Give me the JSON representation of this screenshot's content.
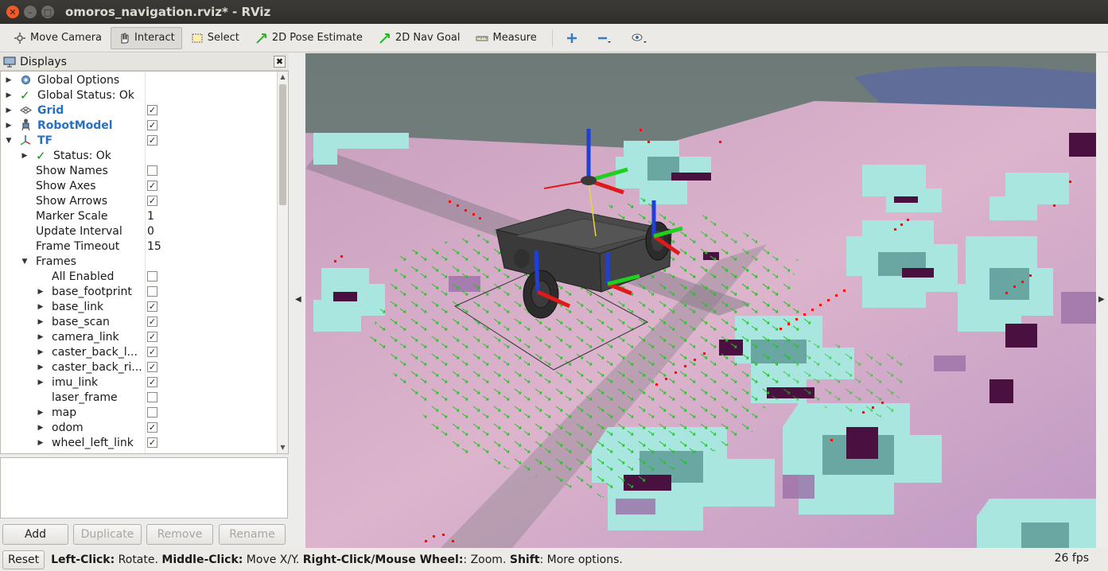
{
  "window": {
    "title": "omoros_navigation.rviz* - RViz"
  },
  "toolbar": {
    "move_camera": "Move Camera",
    "interact": "Interact",
    "select": "Select",
    "pose_estimate": "2D Pose Estimate",
    "nav_goal": "2D Nav Goal",
    "measure": "Measure"
  },
  "panel": {
    "title": "Displays",
    "close": "✖",
    "rows": [
      {
        "name": "Global Options"
      },
      {
        "name": "Global Status: Ok"
      },
      {
        "name": "Grid",
        "checked": "✓"
      },
      {
        "name": "RobotModel",
        "checked": "✓"
      },
      {
        "name": "TF",
        "checked": "✓"
      },
      {
        "name": "Status: Ok"
      },
      {
        "name": "Show Names",
        "checked": ""
      },
      {
        "name": "Show Axes",
        "checked": "✓"
      },
      {
        "name": "Show Arrows",
        "checked": "✓"
      },
      {
        "name": "Marker Scale",
        "value": "1"
      },
      {
        "name": "Update Interval",
        "value": "0"
      },
      {
        "name": "Frame Timeout",
        "value": "15"
      },
      {
        "name": "Frames"
      },
      {
        "name": "All Enabled",
        "checked": ""
      },
      {
        "name": "base_footprint",
        "checked": ""
      },
      {
        "name": "base_link",
        "checked": "✓"
      },
      {
        "name": "base_scan",
        "checked": "✓"
      },
      {
        "name": "camera_link",
        "checked": "✓"
      },
      {
        "name": "caster_back_l...",
        "checked": "✓"
      },
      {
        "name": "caster_back_ri...",
        "checked": "✓"
      },
      {
        "name": "imu_link",
        "checked": "✓"
      },
      {
        "name": "laser_frame",
        "checked": ""
      },
      {
        "name": "map",
        "checked": ""
      },
      {
        "name": "odom",
        "checked": "✓"
      },
      {
        "name": "wheel_left_link",
        "checked": "✓"
      }
    ]
  },
  "buttons": {
    "add": "Add",
    "duplicate": "Duplicate",
    "remove": "Remove",
    "rename": "Rename"
  },
  "status": {
    "reset": "Reset",
    "left_click": "Left-Click:",
    "left_click_desc": " Rotate. ",
    "middle_click": "Middle-Click:",
    "middle_click_desc": " Move X/Y. ",
    "right_click": "Right-Click/Mouse Wheel:",
    "right_click_desc": ": Zoom. ",
    "shift": "Shift",
    "shift_desc": ": More options.",
    "fps": "26 fps"
  },
  "colors": {
    "accent_blue": "#2a70c0",
    "close_orange": "#f15a2a",
    "costmap_pink": "#e8b8c8",
    "costmap_cyan": "#a8e8e0",
    "costmap_dark": "#4a1040",
    "arrow_green": "#22cc22",
    "scan_red": "#ee1111"
  }
}
